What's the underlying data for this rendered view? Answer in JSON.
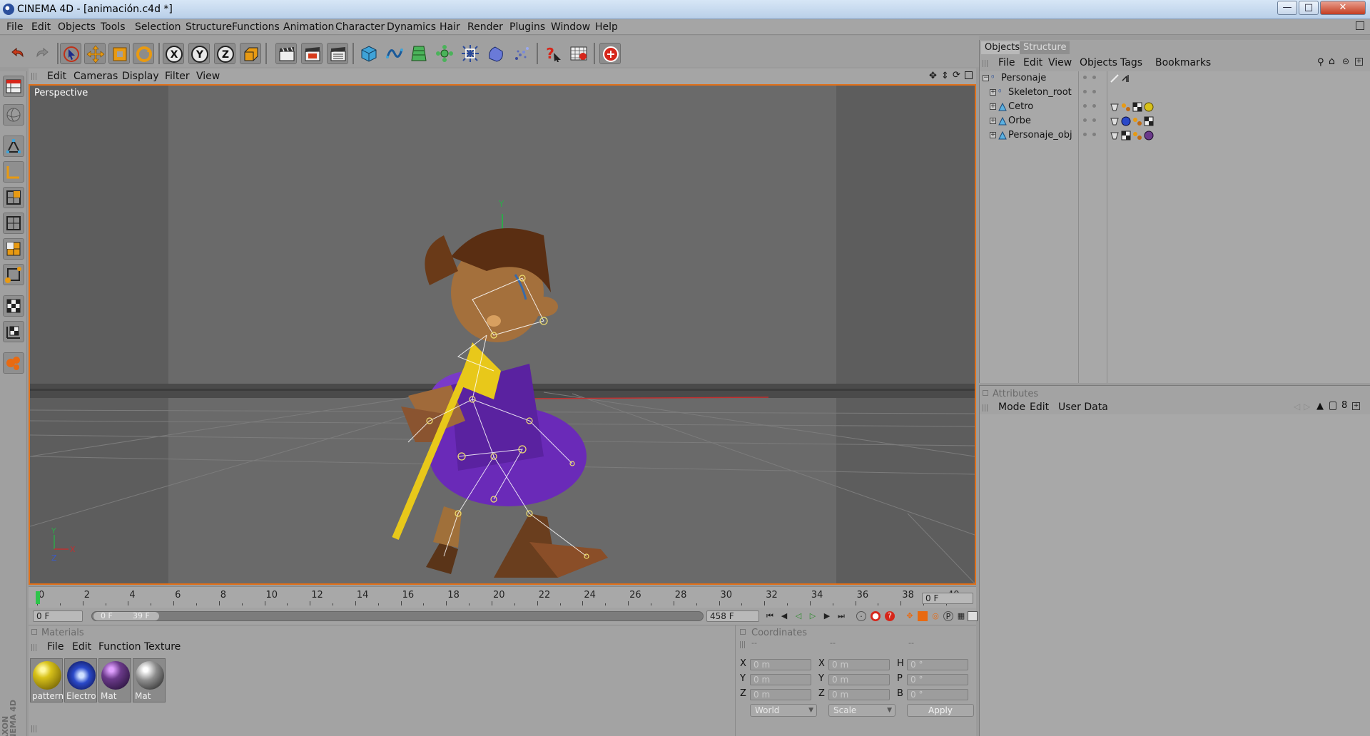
{
  "window": {
    "title": "CINEMA 4D - [animación.c4d *]",
    "minimize": "—",
    "maximize": "□",
    "close": "✕"
  },
  "menubar": [
    "File",
    "Edit",
    "Objects",
    "Tools",
    "Selection",
    "Structure",
    "Functions",
    "Animation",
    "Character",
    "Dynamics",
    "Hair",
    "Render",
    "Plugins",
    "Window",
    "Help"
  ],
  "toolbar": {
    "x_axis": "X",
    "y_axis": "Y",
    "z_axis": "Z"
  },
  "viewport": {
    "menu": [
      "Edit",
      "Cameras",
      "Display",
      "Filter",
      "View"
    ],
    "label": "Perspective",
    "axis_y": "Y",
    "axis_x": "X",
    "axis_z": "Z",
    "world_y": "Y"
  },
  "timeline": {
    "ticks": [
      "0",
      "2",
      "4",
      "6",
      "8",
      "10",
      "12",
      "14",
      "16",
      "18",
      "20",
      "22",
      "24",
      "26",
      "28",
      "30",
      "32",
      "34",
      "36",
      "38",
      "40"
    ],
    "current_frame": "0 F",
    "start_field": "0 F",
    "range_start": "0 F",
    "range_end": "39 F",
    "end_field": "458 F"
  },
  "materials": {
    "title": "Materials",
    "menu": [
      "File",
      "Edit",
      "Function",
      "Texture"
    ],
    "items": [
      {
        "name": "pattern",
        "color": "#d8c21a"
      },
      {
        "name": "Electro",
        "color": "#2a49c9"
      },
      {
        "name": "Mat",
        "color": "#6b3a8a"
      },
      {
        "name": "Mat",
        "color": "#8d8d8d"
      }
    ]
  },
  "coordinates": {
    "title": "Coordinates",
    "col_dash_1": "--",
    "col_dash_2": "--",
    "col_dash_3": "--",
    "rows": [
      {
        "l1": "X",
        "v1": "0 m",
        "l2": "X",
        "v2": "0 m",
        "l3": "H",
        "v3": "0 °"
      },
      {
        "l1": "Y",
        "v1": "0 m",
        "l2": "Y",
        "v2": "0 m",
        "l3": "P",
        "v3": "0 °"
      },
      {
        "l1": "Z",
        "v1": "0 m",
        "l2": "Z",
        "v2": "0 m",
        "l3": "B",
        "v3": "0 °"
      }
    ],
    "space": "World",
    "mode": "Scale",
    "apply": "Apply"
  },
  "objects_panel": {
    "tab_objects": "Objects",
    "tab_structure": "Structure",
    "menu": [
      "File",
      "Edit",
      "View",
      "Objects",
      "Tags",
      "Bookmarks"
    ],
    "tree": [
      {
        "name": "Personaje",
        "expand": "−",
        "level": 0
      },
      {
        "name": "Skeleton_root",
        "expand": "+",
        "level": 1
      },
      {
        "name": "Cetro",
        "expand": "+",
        "level": 1
      },
      {
        "name": "Orbe",
        "expand": "+",
        "level": 1
      },
      {
        "name": "Personaje_obj",
        "expand": "+",
        "level": 1
      }
    ]
  },
  "attributes_panel": {
    "title": "Attributes",
    "menu": [
      "Mode",
      "Edit",
      "User Data"
    ]
  }
}
